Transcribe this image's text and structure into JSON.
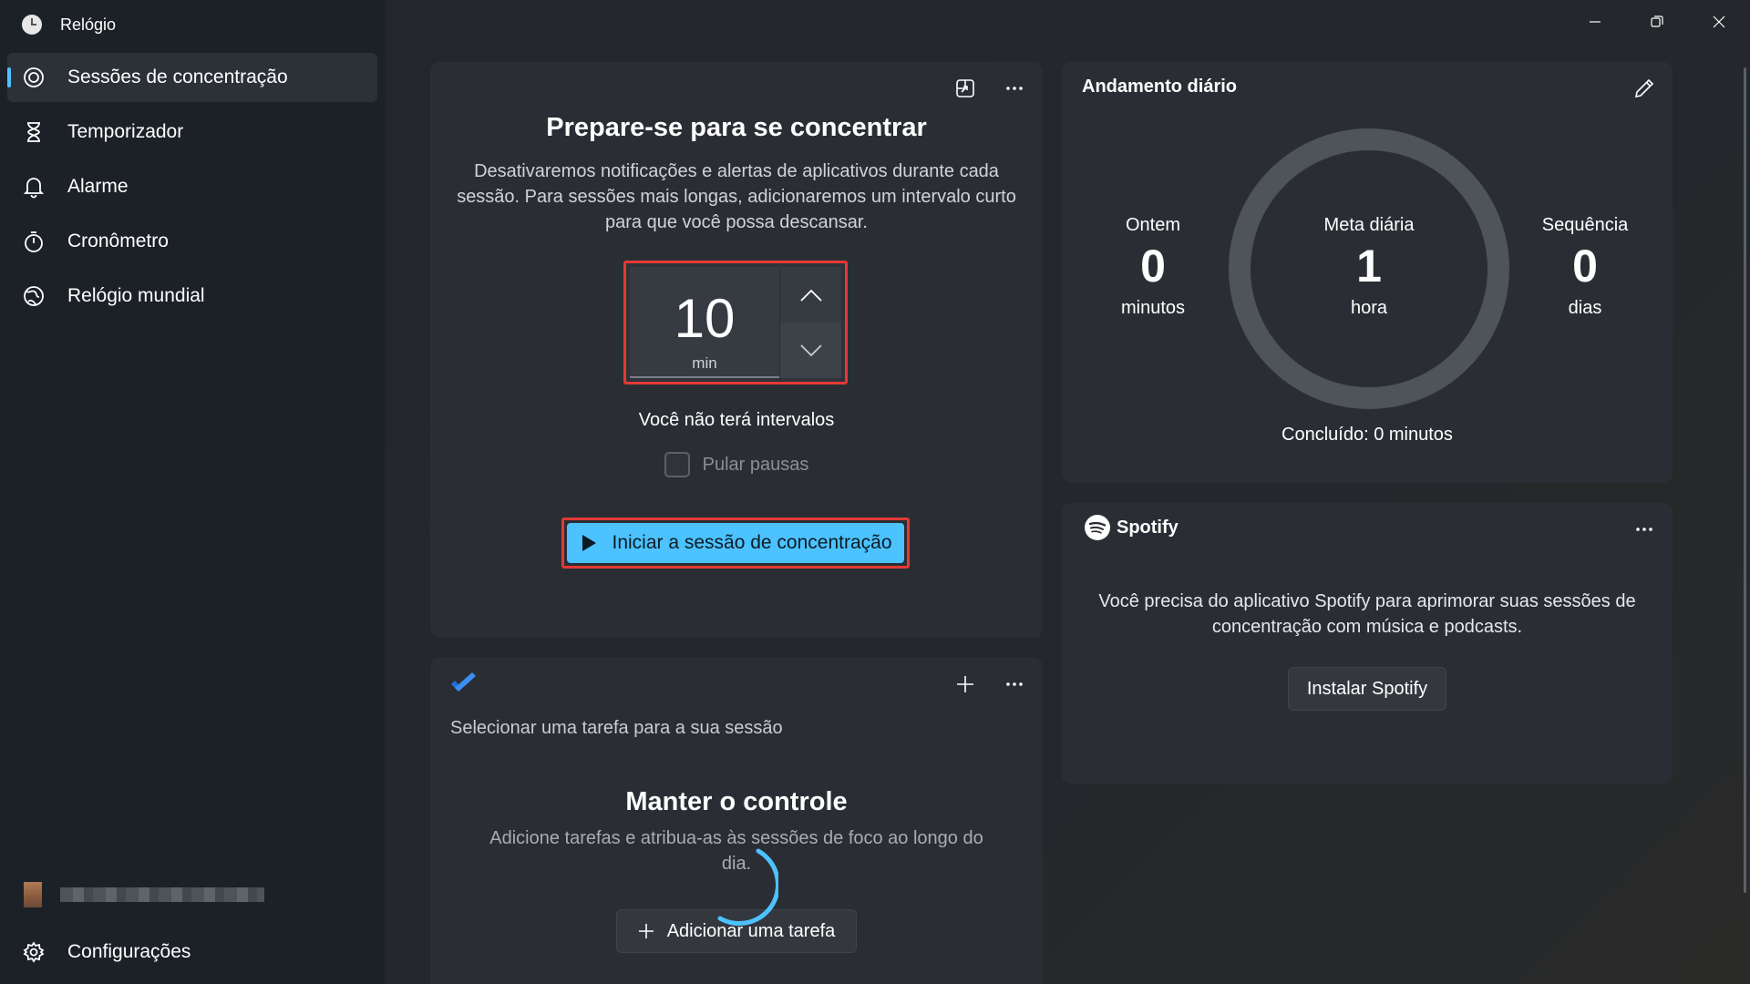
{
  "app": {
    "title": "Relógio"
  },
  "sidebar": {
    "items": [
      {
        "label": "Sessões de concentração",
        "icon": "focus-icon",
        "active": true
      },
      {
        "label": "Temporizador",
        "icon": "hourglass-icon"
      },
      {
        "label": "Alarme",
        "icon": "bell-icon"
      },
      {
        "label": "Cronômetro",
        "icon": "stopwatch-icon"
      },
      {
        "label": "Relógio mundial",
        "icon": "globe-icon"
      }
    ],
    "user": {
      "name": ""
    },
    "settings_label": "Configurações"
  },
  "focus": {
    "title": "Prepare-se para se concentrar",
    "description": "Desativaremos notificações e alertas de aplicativos durante cada sessão. Para sessões mais longas, adicionaremos um intervalo curto para que você possa descansar.",
    "duration_value": "10",
    "duration_unit": "min",
    "breaks_text": "Você não terá intervalos",
    "skip_breaks_label": "Pular pausas",
    "skip_breaks_checked": false,
    "start_button": "Iniciar a sessão de concentração"
  },
  "daily": {
    "title": "Andamento diário",
    "yesterday": {
      "label": "Ontem",
      "value": "0",
      "unit": "minutos"
    },
    "goal": {
      "label": "Meta diária",
      "value": "1",
      "unit": "hora"
    },
    "streak": {
      "label": "Sequência",
      "value": "0",
      "unit": "dias"
    },
    "completed": "Concluído: 0 minutos",
    "progress_fraction": 0
  },
  "spotify": {
    "brand": "Spotify",
    "message": "Você precisa do aplicativo Spotify para aprimorar suas sessões de concentração com música e podcasts.",
    "install_button": "Instalar Spotify"
  },
  "tasks": {
    "select_text": "Selecionar uma tarefa para a sua sessão",
    "title": "Manter o controle",
    "description": "Adicione tarefas e atribua-as às sessões de foco ao longo do dia.",
    "add_button": "Adicionar uma tarefa"
  },
  "colors": {
    "accent": "#4cc2ff",
    "highlight_border": "#e53935",
    "todo_blue": "#2f7ff0"
  }
}
